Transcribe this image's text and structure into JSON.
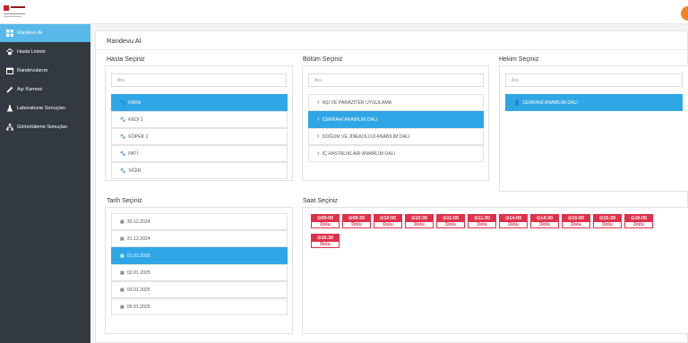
{
  "sidebar": {
    "items": [
      {
        "label": "Randevu Al",
        "icon": "grid-icon",
        "active": true
      },
      {
        "label": "Hasta Listesi",
        "icon": "paw-icon",
        "active": false
      },
      {
        "label": "Randevularım",
        "icon": "calendar-icon",
        "active": false
      },
      {
        "label": "Aşı Karnesi",
        "icon": "syringe-icon",
        "active": false
      },
      {
        "label": "Laboratuvar Sonuçları",
        "icon": "flask-icon",
        "active": false
      },
      {
        "label": "Görüntüleme Sonuçları",
        "icon": "sitemap-icon",
        "active": false
      }
    ]
  },
  "main": {
    "title": "Randevu Al",
    "patient": {
      "label": "Hasta Seçiniz",
      "search_placeholder": "Ara",
      "items": [
        {
          "label": "KARA",
          "selected": true
        },
        {
          "label": "KEDİ 1",
          "selected": false
        },
        {
          "label": "KÖPEK 1",
          "selected": false
        },
        {
          "label": "PATİ",
          "selected": false
        },
        {
          "label": "SIĞIR",
          "selected": false
        }
      ]
    },
    "department": {
      "label": "Bölüm Seçiniz",
      "search_placeholder": "Ara",
      "items": [
        {
          "label": "AŞI VE PARAZİTER UYGULAMA",
          "selected": false
        },
        {
          "label": "CERRAHİ ANABİLİM DALI",
          "selected": true
        },
        {
          "label": "DOĞUM VE JİNEKOLOJİ ANABİLİM DALI",
          "selected": false
        },
        {
          "label": "İÇ HASTALIKLARI ANABİLİM DALI",
          "selected": false
        }
      ]
    },
    "doctor": {
      "label": "Hekim Seçiniz",
      "search_placeholder": "Ara",
      "items": [
        {
          "label": "CERRAHİ ANABİLİM DALI",
          "selected": true
        }
      ]
    },
    "date": {
      "label": "Tarih Seçiniz",
      "items": [
        {
          "label": "30.12.2024",
          "selected": false
        },
        {
          "label": "31.12.2024",
          "selected": false
        },
        {
          "label": "01.01.2025",
          "selected": true
        },
        {
          "label": "02.01.2025",
          "selected": false
        },
        {
          "label": "03.01.2025",
          "selected": false
        },
        {
          "label": "06.01.2025",
          "selected": false
        }
      ]
    },
    "time": {
      "label": "Saat Seçiniz",
      "slots": [
        {
          "time": "09:00",
          "status": "Dolu"
        },
        {
          "time": "09:30",
          "status": "Dolu"
        },
        {
          "time": "10:00",
          "status": "Dolu"
        },
        {
          "time": "10:30",
          "status": "Dolu"
        },
        {
          "time": "11:00",
          "status": "Dolu"
        },
        {
          "time": "11:30",
          "status": "Dolu"
        },
        {
          "time": "14:00",
          "status": "Dolu"
        },
        {
          "time": "14:30",
          "status": "Dolu"
        },
        {
          "time": "15:00",
          "status": "Dolu"
        },
        {
          "time": "15:30",
          "status": "Dolu"
        },
        {
          "time": "16:00",
          "status": "Dolu"
        },
        {
          "time": "16:30",
          "status": "Dolu"
        }
      ]
    }
  },
  "colors": {
    "sidebar_bg": "#333940",
    "active_nav": "#58b8e9",
    "selected_item": "#2fa6e6",
    "slot_full": "#e0304a",
    "user_avatar": "#f0842c"
  },
  "icons": {
    "patient_item": "paw-icon",
    "department_item": "stethoscope-icon",
    "doctor_item": "user-md-icon",
    "date_item": "calendar-icon",
    "slot": "clock-icon"
  }
}
